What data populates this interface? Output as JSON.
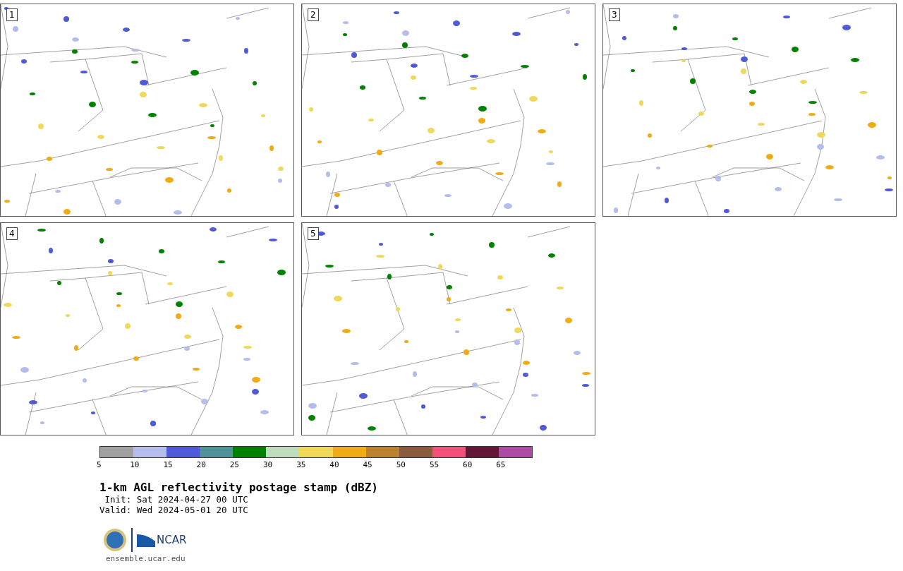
{
  "panels": [
    {
      "label": "1"
    },
    {
      "label": "2"
    },
    {
      "label": "3"
    },
    {
      "label": "4"
    },
    {
      "label": "5"
    }
  ],
  "colorbar": {
    "segments": [
      {
        "color": "#a0a0a0"
      },
      {
        "color": "#b4bdeb"
      },
      {
        "color": "#505ad6"
      },
      {
        "color": "#4f9399"
      },
      {
        "color": "#008200"
      },
      {
        "color": "#bfdcbc"
      },
      {
        "color": "#f0d95a"
      },
      {
        "color": "#efac14"
      },
      {
        "color": "#bb8331"
      },
      {
        "color": "#8a5b3e"
      },
      {
        "color": "#f5507a"
      },
      {
        "color": "#631735"
      },
      {
        "color": "#ad4aa5"
      }
    ],
    "ticks": [
      "5",
      "10",
      "15",
      "20",
      "25",
      "30",
      "35",
      "40",
      "45",
      "50",
      "55",
      "60",
      "65"
    ]
  },
  "title": "1-km AGL reflectivity postage stamp (dBZ)",
  "init": " Init: Sat 2024-04-27 00 UTC",
  "valid": "Valid: Wed 2024-05-01 20 UTC",
  "logo_text": "NCAR",
  "url": "ensemble.ucar.edu"
}
